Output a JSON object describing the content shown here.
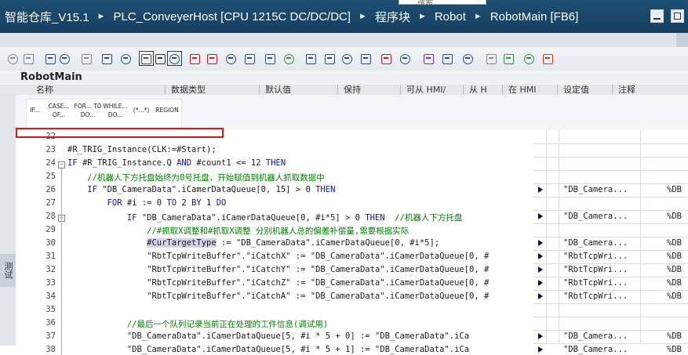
{
  "window": {
    "breadcrumbs": [
      "智能仓库_V15.1",
      "PLC_ConveyerHost [CPU 1215C DC/DC/DC]",
      "程序块",
      "Robot",
      "RobotMain [FB6]"
    ],
    "search_placeholder": "搜索"
  },
  "block_title": "RobotMain",
  "interface_columns": [
    "名称",
    "数据类型",
    "默认值",
    "保持",
    "可从 HMI/",
    "从 H",
    "在 HMI",
    "设定值",
    "注释"
  ],
  "palette": [
    {
      "label": "IF..."
    },
    {
      "label": "CASE... OF..."
    },
    {
      "label": "FOR... TO DO..."
    },
    {
      "label": "WHILE... DO..."
    },
    {
      "label": "(*...*)"
    },
    {
      "label": "REGION"
    }
  ],
  "side_strip_label": "测试",
  "code_lines": [
    {
      "n": "22",
      "text": ""
    },
    {
      "n": "23",
      "text": "#R_TRIG_Instance(CLK:=#Start);"
    },
    {
      "n": "24",
      "text": "IF #R_TRIG_Instance.Q AND #count1 <= 12 THEN"
    },
    {
      "n": "25",
      "text": "    //机器人下方托盘始终为0号托盘，开始赋值到机器人抓取数据中"
    },
    {
      "n": "26",
      "text": "    IF \"DB_CameraData\".iCamerDataQueue[0, 15] > 0 THEN"
    },
    {
      "n": "27",
      "text": "        FOR #i := 0 TO 2 BY 1 DO"
    },
    {
      "n": "28",
      "text": "            IF \"DB_CameraData\".iCamerDataQueue[0, #i*5] > 0 THEN  //机器人下方托盘"
    },
    {
      "n": "29",
      "text": "                //#抓取X调整和#抓取X调整 分别机器人总的偏差补偿量,需要根据实际"
    },
    {
      "n": "30",
      "text": "                #CurTargetType := \"DB_CameraData\".iCamerDataQueue[0, #i*5];"
    },
    {
      "n": "31",
      "text": "                \"RbtTcpWriteBuffer\".\"iCatchX\" := \"DB_CameraData\".iCamerDataQueue[0, #"
    },
    {
      "n": "32",
      "text": "                \"RbtTcpWriteBuffer\".\"iCatchY\" := \"DB_CameraData\".iCamerDataQueue[0, #"
    },
    {
      "n": "33",
      "text": "                \"RbtTcpWriteBuffer\".\"iCatchZ\" := \"DB_CameraData\".iCamerDataQueue[0, #"
    },
    {
      "n": "34",
      "text": "                \"RbtTcpWriteBuffer\".\"iCatchA\" := \"DB_CameraData\".iCamerDataQueue[0, #"
    },
    {
      "n": "35",
      "text": ""
    },
    {
      "n": "36",
      "text": "            //最后一个队列记录当前正在处理的工件信息(调试用)"
    },
    {
      "n": "37",
      "text": "            \"DB_CameraData\".iCamerDataQueue[5, #i * 5 + 0] := \"DB_CameraData\".iCa"
    },
    {
      "n": "38",
      "text": "            \"DB_CameraData\".iCamerDataQueue[5, #i * 5 + 1] := \"DB_CameraData\".iCa"
    }
  ],
  "highlight_token": "#CurTargetType",
  "right_rows": [
    {
      "line": "26",
      "value": "\"DB_Camera...",
      "addr": "%DB"
    },
    {
      "line": "28",
      "value": "\"DB_Camera...",
      "addr": "%DB"
    },
    {
      "line": "30",
      "value": "\"DB_Camera...",
      "addr": "%DB"
    },
    {
      "line": "31",
      "value": "\"RbtTcpWri...",
      "addr": "%DB"
    },
    {
      "line": "32",
      "value": "\"RbtTcpWri...",
      "addr": "%DB"
    },
    {
      "line": "33",
      "value": "\"RbtTcpWri...",
      "addr": "%DB"
    },
    {
      "line": "34",
      "value": "\"RbtTcpWri...",
      "addr": "%DB"
    },
    {
      "line": "37",
      "value": "\"DB_Camera...",
      "addr": "%DB"
    },
    {
      "line": "38",
      "value": "\"DB_Camera...",
      "addr": "%DB"
    }
  ],
  "colors": {
    "titlebar": "#1e4f73",
    "keyword": "#0d1a9e",
    "comment": "#008000",
    "annotation_box": "#d11a1a"
  }
}
